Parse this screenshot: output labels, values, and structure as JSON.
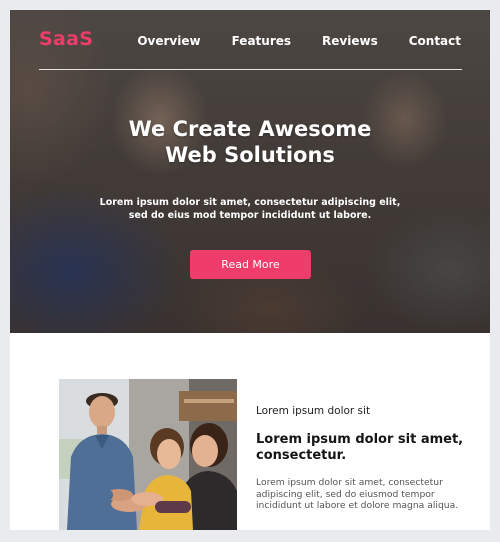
{
  "brand": {
    "logo": "SaaS",
    "accent_color": "#ee3d6a"
  },
  "nav": {
    "items": [
      {
        "label": "Overview"
      },
      {
        "label": "Features"
      },
      {
        "label": "Reviews"
      },
      {
        "label": "Contact"
      }
    ]
  },
  "hero": {
    "title_line1": "We Create Awesome",
    "title_line2": "Web Solutions",
    "subtitle_line1": "Lorem ipsum dolor sit amet, consectetur adipiscing elit,",
    "subtitle_line2": "sed do eius mod tempor incididunt ut labore.",
    "cta_label": "Read More",
    "background_image": "team-meeting-photo"
  },
  "feature": {
    "image": "team-hands-photo",
    "eyebrow": "Lorem ipsum dolor sit",
    "heading": "Lorem ipsum dolor sit amet, consectetur.",
    "body": "Lorem ipsum dolor sit amet, consectetur adipiscing elit, sed do eiusmod tempor incididunt ut labore et dolore magna aliqua."
  }
}
